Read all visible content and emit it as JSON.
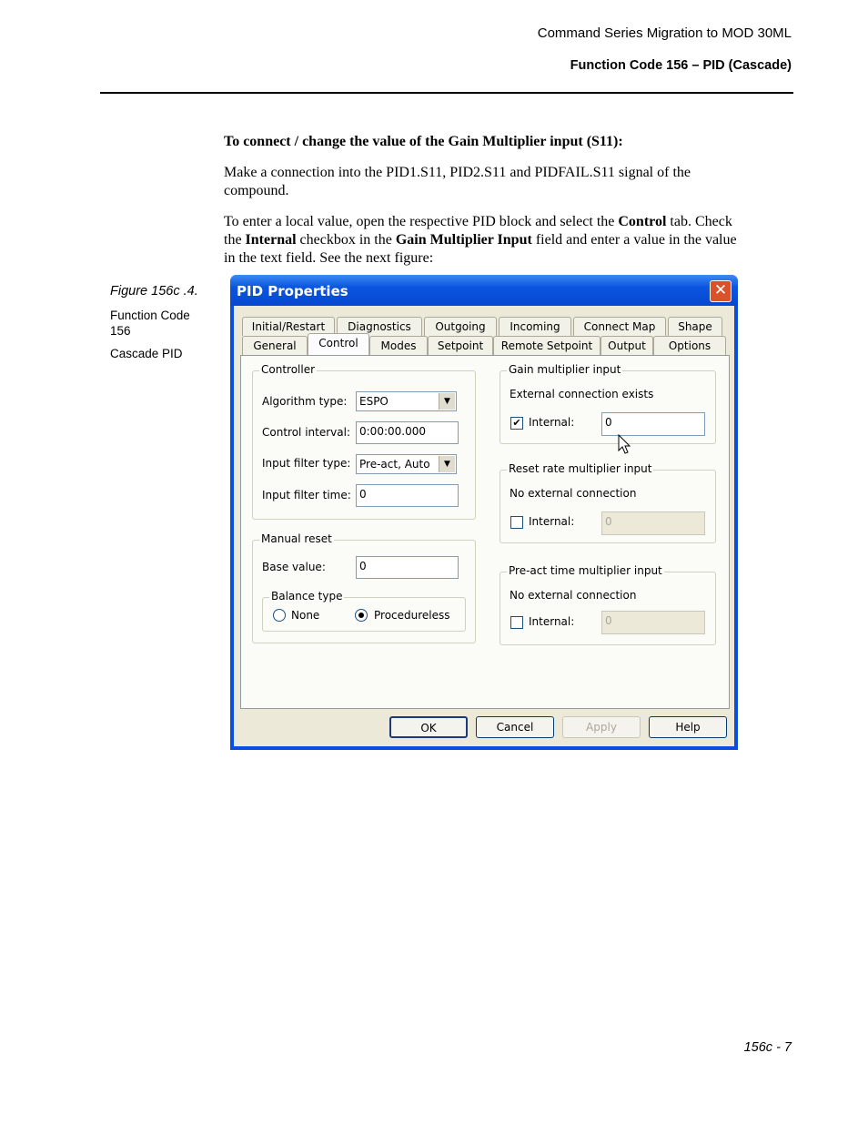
{
  "header": {
    "title": "Command Series Migration to MOD 30ML",
    "subtitle": "Function Code 156 – PID (Cascade)"
  },
  "body": {
    "heading": "To connect / change the value of the Gain Multiplier input (S11):",
    "para1_line1": "Make a connection into the PID1.S11, PID2.S11 and PIDFAIL.S11 signal of the",
    "para1_line2": "compound.",
    "p2_l1_a": "To enter a local value, open the respective PID block and select the ",
    "p2_l1_b": "Control",
    "p2_l1_c": " tab. Check",
    "p2_l2_a": "the ",
    "p2_l2_b": "Internal",
    "p2_l2_c": " checkbox in the ",
    "p2_l2_d": "Gain Multiplier Input",
    "p2_l2_e": " field and enter a value in the  value",
    "p2_l3": "in the text field. See the next figure:"
  },
  "figure": {
    "caption": "Figure 156c .4.",
    "side1_line1": "Function Code",
    "side1_line2": "156",
    "side2": "Cascade PID"
  },
  "dialog": {
    "title": "PID Properties",
    "close_glyph": "✕",
    "tabs_row1": [
      "Initial/Restart",
      "Diagnostics",
      "Outgoing",
      "Incoming",
      "Connect Map",
      "Shape"
    ],
    "tabs_row2": [
      "General",
      "Control",
      "Modes",
      "Setpoint",
      "Remote Setpoint",
      "Output",
      "Options"
    ],
    "controller": {
      "title": "Controller",
      "algorithm_label": "Algorithm type:",
      "algorithm_value": "ESPO",
      "interval_label": "Control interval:",
      "interval_value": "0:00:00.000",
      "filter_type_label": "Input filter type:",
      "filter_type_value": "Pre-act, Auto",
      "filter_time_label": "Input filter time:",
      "filter_time_value": "0"
    },
    "manual_reset": {
      "title": "Manual reset",
      "base_label": "Base value:",
      "base_value": "0",
      "balance_title": "Balance type",
      "opt_none": "None",
      "opt_procedureless": "Procedureless"
    },
    "gain": {
      "title": "Gain multiplier input",
      "status": "External connection exists",
      "internal_label": "Internal:",
      "internal_checked": true,
      "value": "0"
    },
    "reset_rate": {
      "title": "Reset rate multiplier input",
      "status": "No external connection",
      "internal_label": "Internal:",
      "value": "0"
    },
    "preact": {
      "title": "Pre-act time multiplier input",
      "status": "No external connection",
      "internal_label": "Internal:",
      "value": "0"
    },
    "buttons": {
      "ok": "OK",
      "cancel": "Cancel",
      "apply": "Apply",
      "help": "Help"
    },
    "dropdown_glyph": "▼",
    "check_glyph": "✔"
  },
  "footer": {
    "page": "156c - 7"
  }
}
